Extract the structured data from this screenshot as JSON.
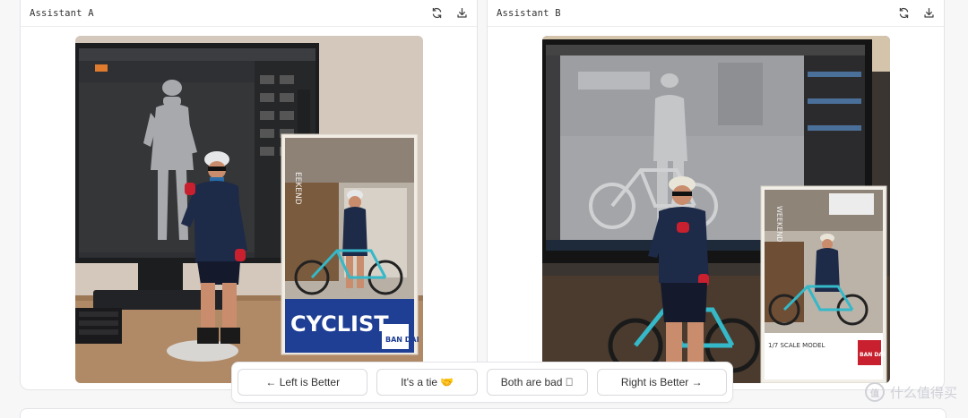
{
  "panels": [
    {
      "title": "Assistant A",
      "actions": [
        "refresh-icon",
        "download-icon"
      ],
      "image": {
        "box_label": "CYCLIST",
        "brand": "BAN DAI",
        "box_sign": "EEKEND"
      }
    },
    {
      "title": "Assistant B",
      "actions": [
        "refresh-icon",
        "download-icon"
      ],
      "image": {
        "box_sign": "WEEKEND",
        "box_caption": "1/7 SCALE MODEL",
        "brand": "BAN DAI"
      }
    }
  ],
  "vote": {
    "left": "← Left is Better",
    "tie": "It's a tie 🤝",
    "bad": "Both are bad ⃠",
    "right": "Right is Better →"
  },
  "watermark": {
    "logo": "值",
    "text": "什么值得买"
  },
  "colors": {
    "background": "#f7f7f8",
    "panel_border": "#e3e4e8",
    "box_blue": "#1f3f95",
    "jersey": "#1d2a48",
    "bike_teal": "#35b8c8"
  }
}
